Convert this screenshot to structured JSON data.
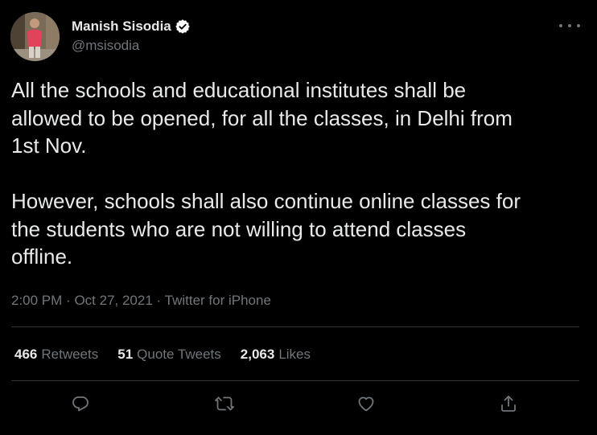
{
  "author": {
    "display_name": "Manish Sisodia",
    "handle": "@msisodia",
    "verified": true
  },
  "tweet": {
    "text": "All the schools and educational institutes shall be\nallowed to be opened, for all the classes, in Delhi from\n1st Nov.\n\nHowever, schools shall also continue online classes for\nthe students who are not willing to attend classes\noffline.",
    "time": "2:00 PM",
    "date": "Oct 27, 2021",
    "source": "Twitter for iPhone",
    "separator": "·"
  },
  "stats": {
    "retweets_count": "466",
    "retweets_label": "Retweets",
    "quotes_count": "51",
    "quotes_label": "Quote Tweets",
    "likes_count": "2,063",
    "likes_label": "Likes"
  },
  "actions": [
    "reply-icon",
    "retweet-icon",
    "like-icon",
    "share-icon"
  ],
  "colors": {
    "background": "#000000",
    "text_primary": "#e7e9ea",
    "text_secondary": "#71767b",
    "divider": "#2f3336",
    "verified_badge": "#ffffff"
  }
}
